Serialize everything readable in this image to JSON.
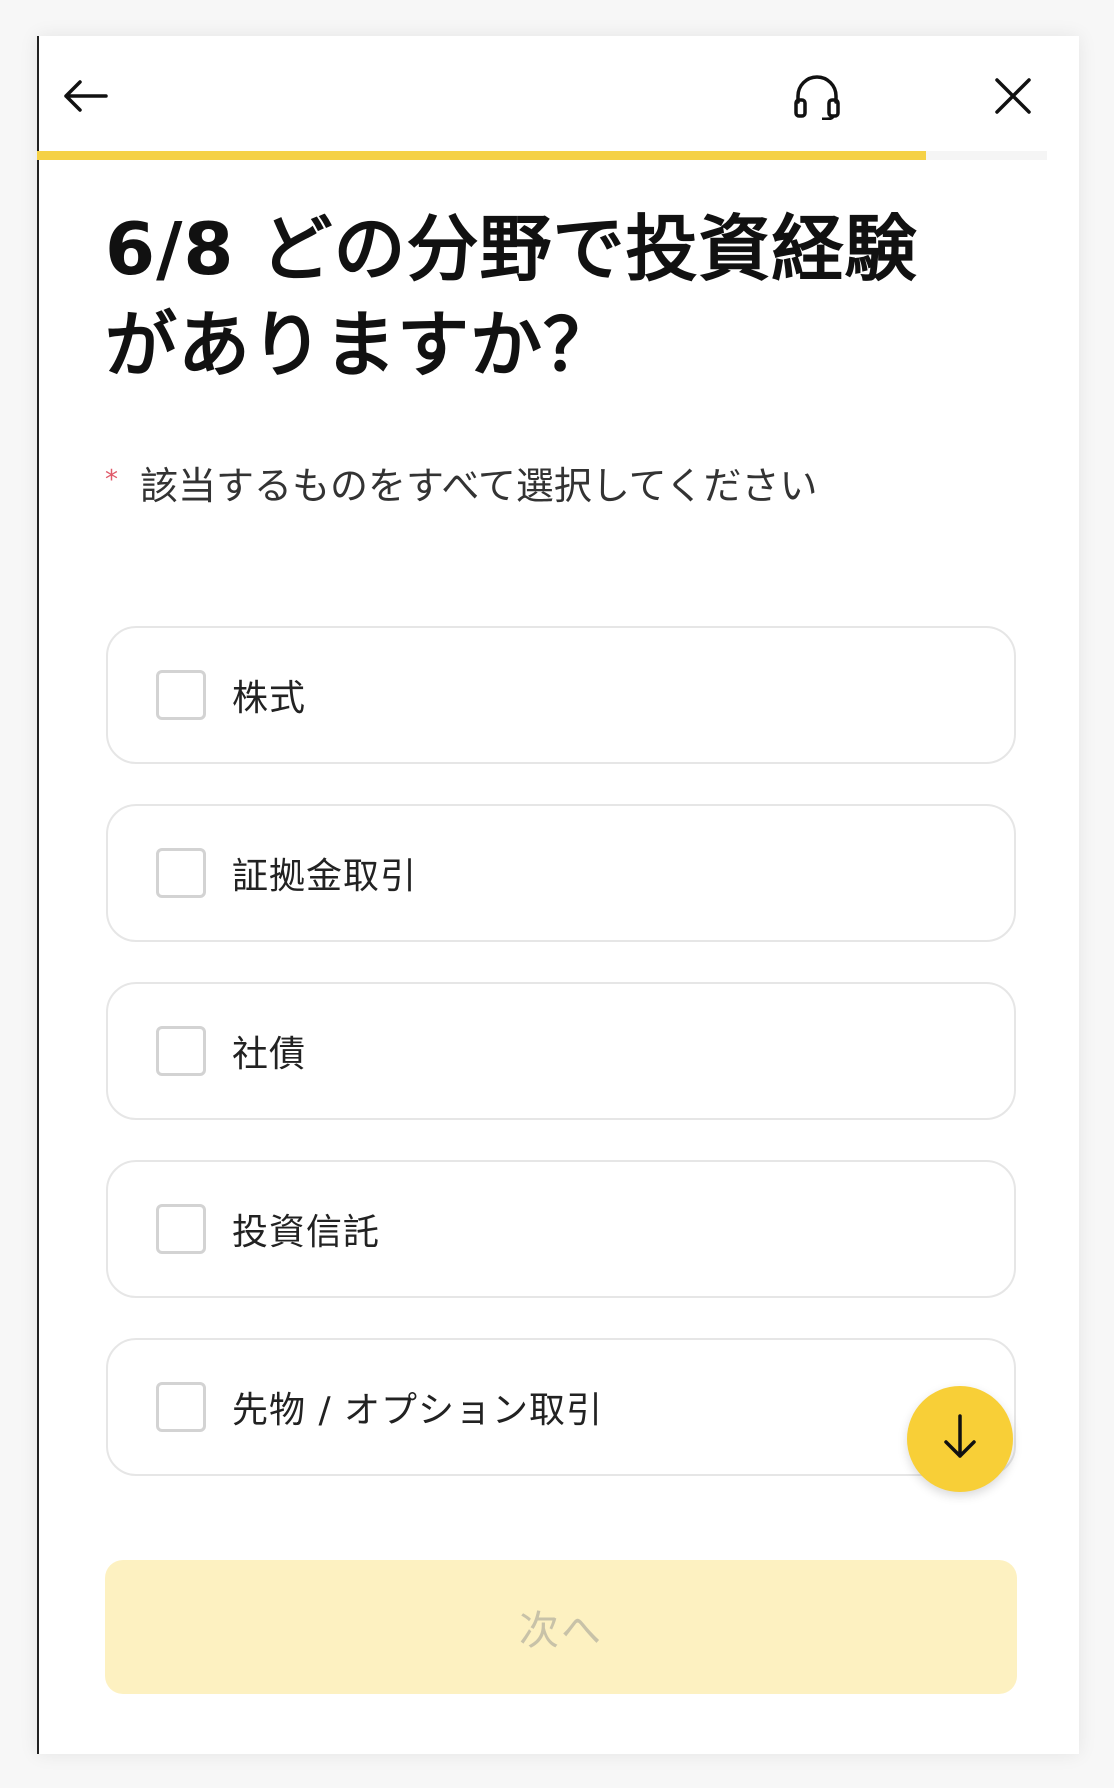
{
  "header": {
    "back_icon": "arrow-left-icon",
    "support_icon": "headphones-icon",
    "close_icon": "close-icon"
  },
  "progress": {
    "current": 6,
    "total": 8,
    "fraction": 0.88,
    "color": "#f5d146"
  },
  "question": {
    "line1": "6/8 どの分野で投資経験",
    "line2": "がありますか？",
    "required_mark": "*",
    "instruction": "該当するものをすべて選択してください"
  },
  "options": [
    {
      "label": "株式",
      "checked": false
    },
    {
      "label": "証拠金取引",
      "checked": false
    },
    {
      "label": "社債",
      "checked": false
    },
    {
      "label": "投資信託",
      "checked": false
    },
    {
      "label": "先物 / オプション取引",
      "checked": false
    }
  ],
  "scroll_button": {
    "icon": "arrow-down-icon",
    "color": "#f8cf37"
  },
  "footer": {
    "next_label": "次へ",
    "next_enabled": false,
    "button_color": "#fdf1c1"
  }
}
